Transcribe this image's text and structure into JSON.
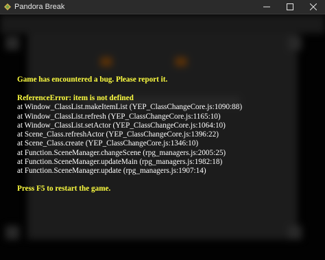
{
  "window": {
    "title": "Pandora Break",
    "controls": {
      "minimize_icon": "minimize-icon",
      "maximize_icon": "maximize-icon",
      "close_icon": "close-icon"
    }
  },
  "error": {
    "heading": "Game has encountered a bug. Please report it.",
    "message": "ReferenceError: item is not defined",
    "stack": [
      "at Window_ClassList.makeItemList (YEP_ClassChangeCore.js:1090:88)",
      "at Window_ClassList.refresh (YEP_ClassChangeCore.js:1165:10)",
      "at Window_ClassList.setActor (YEP_ClassChangeCore.js:1064:10)",
      "at Scene_Class.refreshActor (YEP_ClassChangeCore.js:1396:22)",
      "at Scene_Class.create (YEP_ClassChangeCore.js:1346:10)",
      "at Function.SceneManager.changeScene (rpg_managers.js:2005:25)",
      "at Function.SceneManager.updateMain (rpg_managers.js:1982:18)",
      "at Function.SceneManager.update (rpg_managers.js:1907:14)"
    ],
    "footer": "Press F5 to restart the game."
  },
  "colors": {
    "title_bar": "#2b2b2b",
    "error_highlight": "#ffff40",
    "trace_text": "#ffffff"
  }
}
